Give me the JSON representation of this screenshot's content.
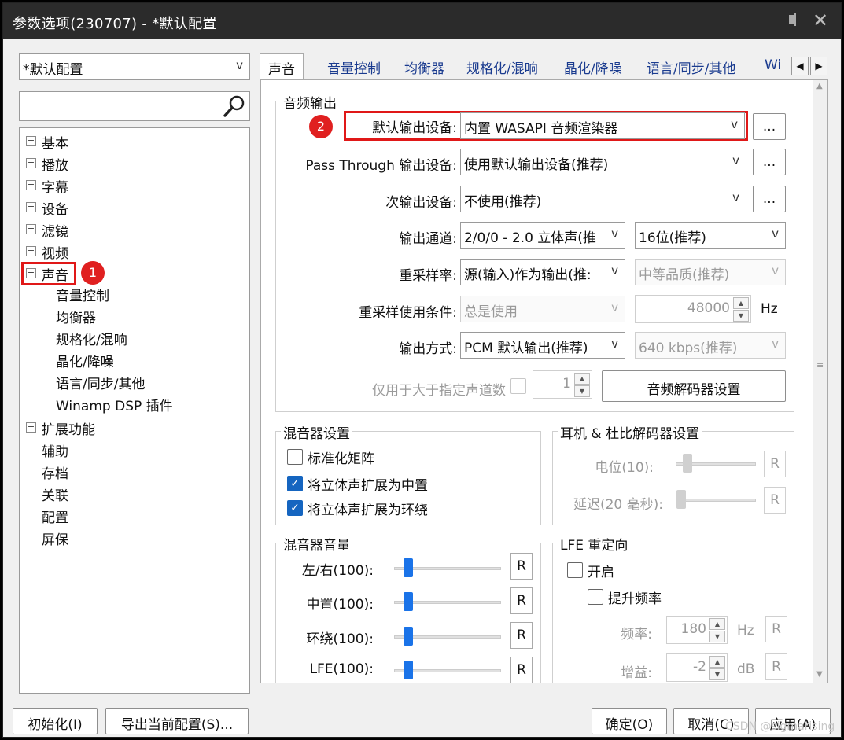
{
  "window": {
    "title": "参数选项(230707) - *默认配置"
  },
  "left": {
    "profile": "*默认配置",
    "tree": [
      {
        "label": "基本",
        "expandable": true
      },
      {
        "label": "播放",
        "expandable": true
      },
      {
        "label": "字幕",
        "expandable": true
      },
      {
        "label": "设备",
        "expandable": true
      },
      {
        "label": "滤镜",
        "expandable": true
      },
      {
        "label": "视频",
        "expandable": true
      },
      {
        "label": "声音",
        "expandable": true,
        "expanded": true
      },
      {
        "label": "扩展功能",
        "expandable": true
      },
      {
        "label": "辅助"
      },
      {
        "label": "存档"
      },
      {
        "label": "关联"
      },
      {
        "label": "配置"
      },
      {
        "label": "屏保"
      }
    ],
    "children": [
      "音量控制",
      "均衡器",
      "规格化/混响",
      "晶化/降噪",
      "语言/同步/其他",
      "Winamp DSP 插件"
    ]
  },
  "tabs": [
    "声音",
    "音量控制",
    "均衡器",
    "规格化/混响",
    "晶化/降噪",
    "语言/同步/其他",
    "Wi"
  ],
  "audio_output": {
    "title": "音频输出",
    "default_device_label": "默认输出设备:",
    "default_device": "内置 WASAPI 音频渲染器",
    "passthrough_label": "Pass Through 输出设备:",
    "passthrough_device": "使用默认输出设备(推荐)",
    "secondary_label": "次输出设备:",
    "secondary_device": "不使用(推荐)",
    "channels_label": "输出通道:",
    "channels": "2/0/0 - 2.0 立体声(推",
    "bitdepth": "16位(推荐)",
    "resample_label": "重采样率:",
    "resample": "源(输入)作为输出(推:",
    "quality": "中等品质(推荐)",
    "resample_cond_label": "重采样使用条件:",
    "resample_cond": "总是使用",
    "rate": "48000",
    "rate_unit": "Hz",
    "method_label": "输出方式:",
    "method": "PCM 默认输出(推荐)",
    "bitrate": "640 kbps(推荐)",
    "channels_gt_label": "仅用于大于指定声道数",
    "channels_gt": "1",
    "decoder_button": "音频解码器设置",
    "more": "..."
  },
  "mixer": {
    "title": "混音器设置",
    "normalize": "标准化矩阵",
    "center": "将立体声扩展为中置",
    "surround": "将立体声扩展为环绕"
  },
  "headphone": {
    "title": "耳机 & 杜比解码器设置",
    "level": "电位(10):",
    "delay": "延迟(20 毫秒):",
    "reset": "R"
  },
  "mixer_volume": {
    "title": "混音器音量",
    "rows": [
      {
        "label": "左/右(100):",
        "value": 100
      },
      {
        "label": "中置(100):",
        "value": 100
      },
      {
        "label": "环绕(100):",
        "value": 100
      },
      {
        "label": "LFE(100):",
        "value": 100
      }
    ],
    "reset": "R"
  },
  "lfe": {
    "title": "LFE 重定向",
    "enable": "开启",
    "boost": "提升频率",
    "freq_label": "频率:",
    "freq": "180",
    "freq_unit": "Hz",
    "gain_label": "增益:",
    "gain": "-2",
    "gain_unit": "dB",
    "reset": "R"
  },
  "annotations": {
    "badge1": "1",
    "badge2": "2"
  },
  "bottom": {
    "init": "初始化(I)",
    "export": "导出当前配置(S)...",
    "ok": "确定(O)",
    "cancel": "取消(C)",
    "apply": "应用(A)"
  },
  "watermark": "CSDN @sigmarising"
}
